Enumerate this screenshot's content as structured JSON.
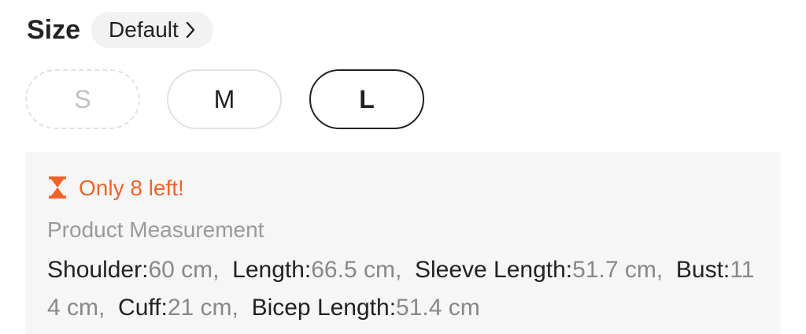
{
  "size": {
    "title": "Size",
    "default_chip": "Default",
    "options": [
      {
        "label": "S",
        "state": "disabled"
      },
      {
        "label": "M",
        "state": "available"
      },
      {
        "label": "L",
        "state": "selected"
      }
    ]
  },
  "stock": {
    "icon": "hourglass-icon",
    "text": "Only 8 left!",
    "color": "#f0642c"
  },
  "measurement": {
    "title": "Product Measurement",
    "items": [
      {
        "label": "Shoulder:",
        "value": "60 cm",
        "sep": ",  "
      },
      {
        "label": "Length:",
        "value": "66.5 cm",
        "sep": ",  "
      },
      {
        "label": "Sleeve Length:",
        "value": "51.7 cm",
        "sep": ",  "
      },
      {
        "label": "Bust:",
        "value": "114 cm",
        "sep": ",  "
      },
      {
        "label": "Cuff:",
        "value": "21 cm",
        "sep": ",  "
      },
      {
        "label": "Bicep Length:",
        "value": "51.4 cm",
        "sep": ""
      }
    ]
  }
}
